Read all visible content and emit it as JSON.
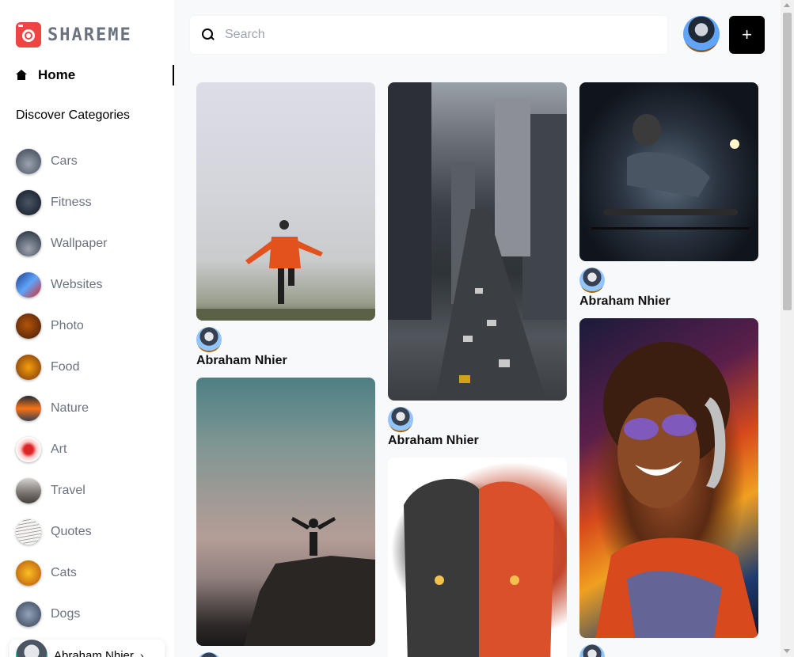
{
  "brand": {
    "name": "SHAREME"
  },
  "sidebar": {
    "home_label": "Home",
    "discover_label": "Discover Categories",
    "categories": [
      {
        "label": "Cars",
        "thumb": "#6b7280"
      },
      {
        "label": "Fitness",
        "thumb": "#1f2937"
      },
      {
        "label": "Wallpaper",
        "thumb": "#374151"
      },
      {
        "label": "Websites",
        "thumb": "#1e3a8a"
      },
      {
        "label": "Photo",
        "thumb": "#7c2d12"
      },
      {
        "label": "Food",
        "thumb": "#b45309"
      },
      {
        "label": "Nature",
        "thumb": "#c2410c"
      },
      {
        "label": "Art",
        "thumb": "#dc2626"
      },
      {
        "label": "Travel",
        "thumb": "#78716c"
      },
      {
        "label": "Quotes",
        "thumb": "#d6d3d1"
      },
      {
        "label": "Cats",
        "thumb": "#d97706"
      },
      {
        "label": "Dogs",
        "thumb": "#64748b"
      }
    ],
    "user_name": "Abraham Nhier"
  },
  "search": {
    "placeholder": "Search",
    "value": ""
  },
  "header": {
    "add_label": "+"
  },
  "pins": [
    {
      "author": "Abraham Nhier"
    },
    {
      "author": "Abraham Nhier"
    },
    {
      "author": "Abraham Nhier"
    }
  ],
  "colors": {
    "accent": "#ef4444",
    "button": "#000000"
  }
}
